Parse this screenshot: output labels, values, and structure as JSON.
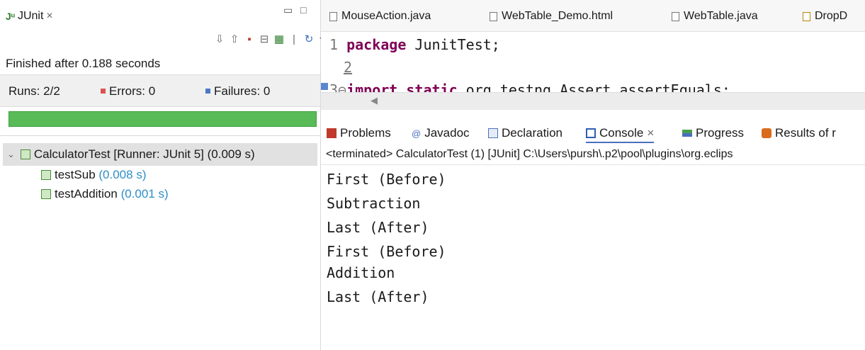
{
  "junit": {
    "tab_label": "JUnit",
    "close": "×",
    "finished_text": "Finished after 0.188 seconds",
    "runs_label": "Runs:",
    "runs_value": "2/2",
    "errors_label": "Errors:",
    "errors_value": "0",
    "failures_label": "Failures:",
    "failures_value": "0",
    "progress_fraction": 1.0,
    "tree": {
      "root_label": "CalculatorTest [Runner: JUnit 5] (0.009 s)",
      "children": [
        {
          "name": "testSub",
          "time": "(0.008 s)"
        },
        {
          "name": "testAddition",
          "time": "(0.001 s)"
        }
      ]
    }
  },
  "editor": {
    "tabs": [
      "MouseAction.java",
      "WebTable_Demo.html",
      "WebTable.java",
      "DropD"
    ],
    "lines": [
      {
        "num": "1",
        "keyword": "package",
        "text": " JunitTest;"
      },
      {
        "num": "2",
        "keyword": "",
        "text": ""
      },
      {
        "num": "3⊖",
        "keyword": "import static",
        "text": " org.testng.Assert.assertEquals;"
      }
    ]
  },
  "console": {
    "tabs": [
      "Problems",
      "Javadoc",
      "Declaration",
      "Console",
      "Progress",
      "Results of r"
    ],
    "active_tab": "Console",
    "close": "×",
    "terminated_line": "<terminated> CalculatorTest (1) [JUnit] C:\\Users\\pursh\\.p2\\pool\\plugins\\org.eclips",
    "output": [
      "First (Before)",
      "Subtraction",
      "Last (After)",
      "First (Before)",
      "Addition",
      "Last (After)"
    ]
  },
  "colors": {
    "progress_green": "#58bb58",
    "link_blue": "#2e8fc7",
    "keyword": "#7f0055"
  }
}
